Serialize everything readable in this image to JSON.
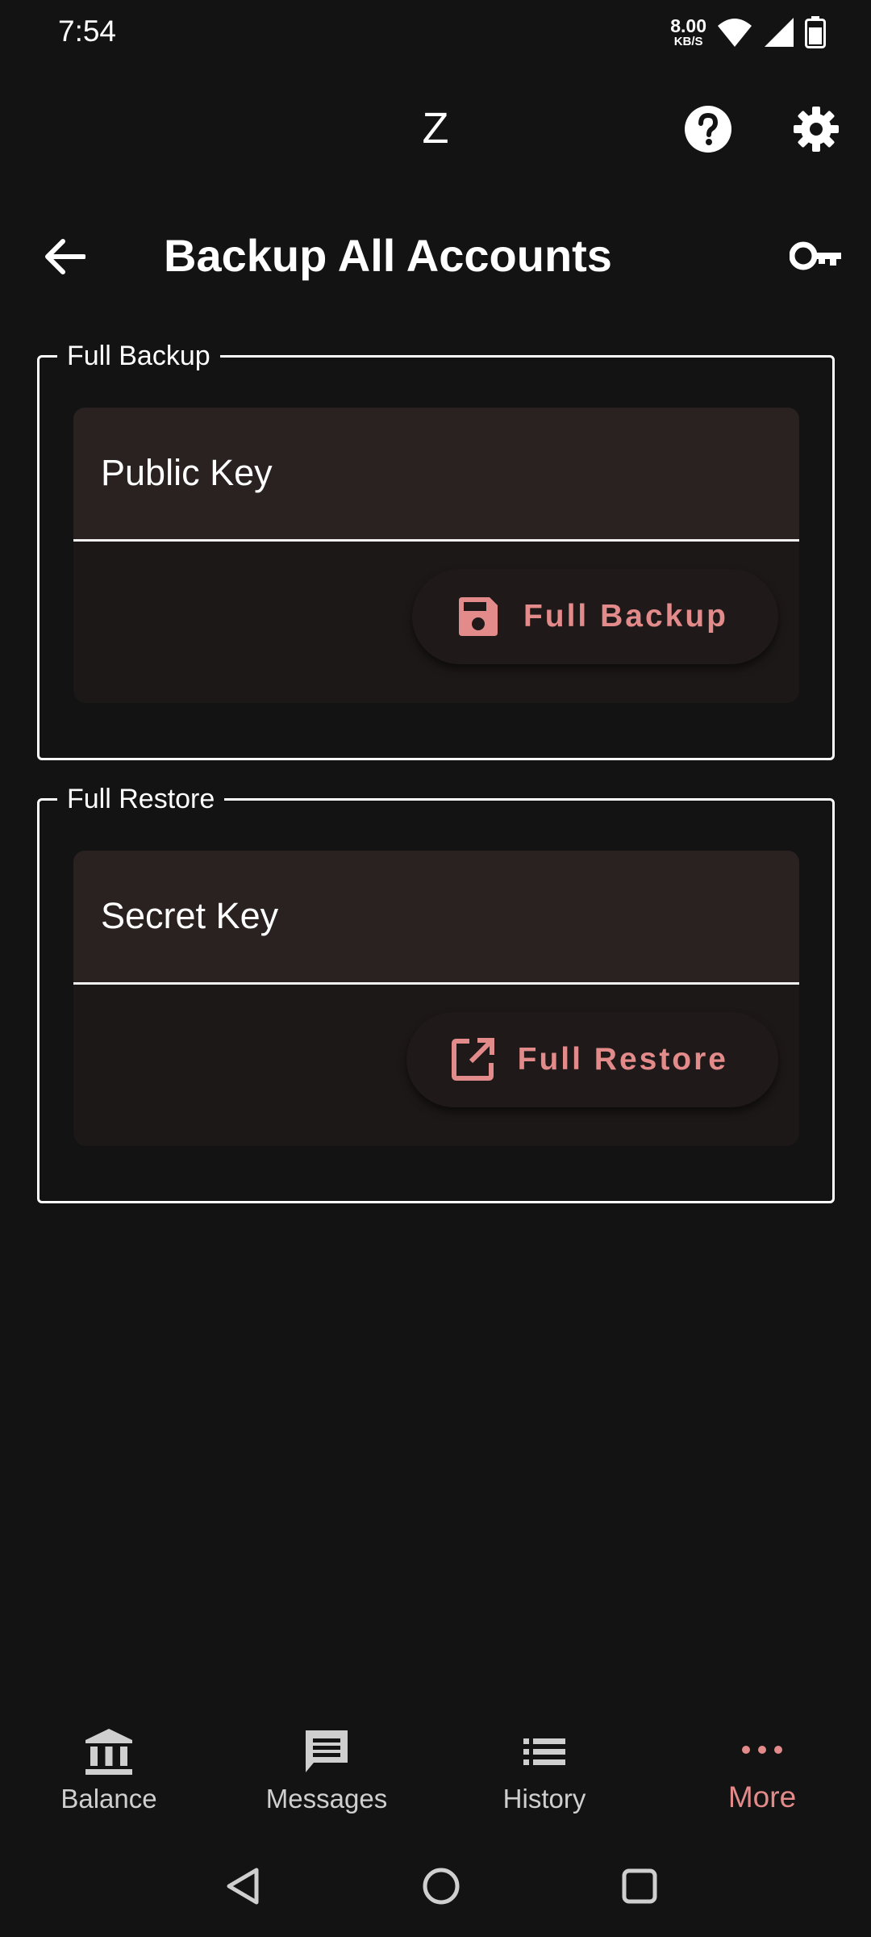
{
  "status": {
    "time": "7:54",
    "net_speed_value": "8.00",
    "net_speed_unit": "KB/S",
    "icons": [
      "wifi-icon",
      "signal-icon",
      "battery-icon"
    ]
  },
  "app_bar": {
    "title": "Z",
    "icons": [
      "help-icon",
      "settings-icon"
    ]
  },
  "page": {
    "title": "Backup All Accounts",
    "icons": [
      "back-arrow-icon",
      "key-icon"
    ]
  },
  "backup": {
    "legend": "Full Backup",
    "field_placeholder": "Public Key",
    "button_label": "Full Backup",
    "button_icon": "save-icon"
  },
  "restore": {
    "legend": "Full Restore",
    "field_placeholder": "Secret Key",
    "button_label": "Full Restore",
    "button_icon": "open-in-new-icon"
  },
  "bottom_nav": {
    "items": [
      {
        "label": "Balance",
        "icon": "bank-icon"
      },
      {
        "label": "Messages",
        "icon": "message-icon"
      },
      {
        "label": "History",
        "icon": "list-icon"
      },
      {
        "label": "More",
        "icon": "more-dots-icon",
        "active": true
      }
    ]
  },
  "colors": {
    "background": "#131313",
    "accent": "#e38a8a",
    "field_bg": "#2a2121",
    "card_bg": "#1d1818"
  }
}
